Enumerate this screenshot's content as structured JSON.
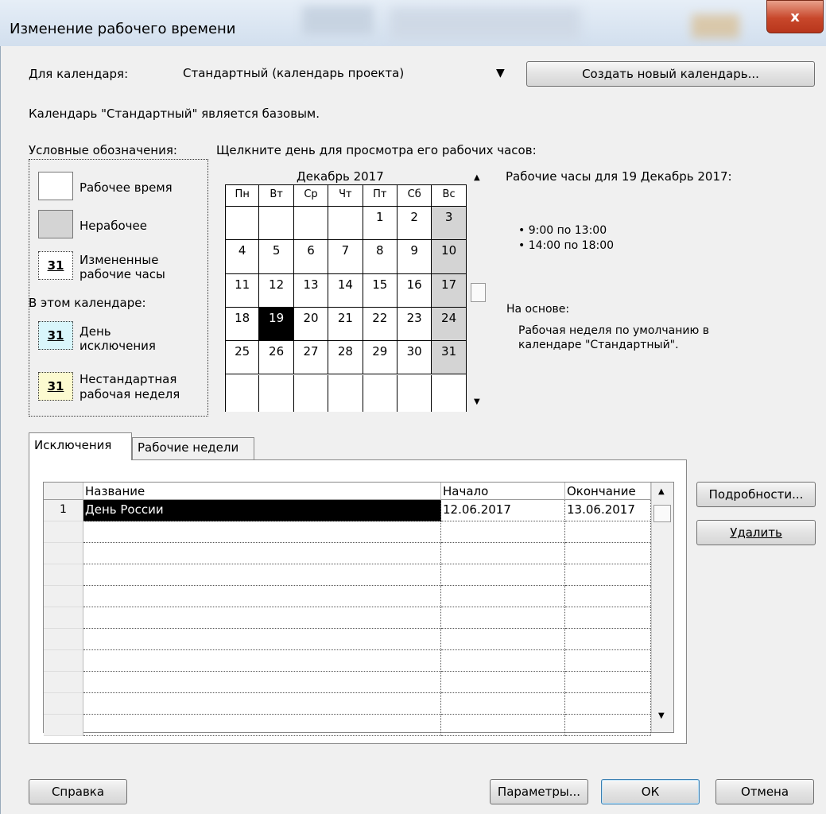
{
  "window": {
    "title": "Изменение рабочего времени",
    "close_glyph": "x"
  },
  "calendar_select": {
    "label": "Для календаря:",
    "value": "Стандартный (календарь проекта)",
    "new_button": "Создать новый календарь..."
  },
  "base_note": "Календарь \"Стандартный\" является базовым.",
  "legend": {
    "title": "Условные обозначения:",
    "working": "Рабочее время",
    "nonworking": "Нерабочее",
    "changed_num": "31",
    "changed_1": "Измененные",
    "changed_2": "рабочие часы",
    "in_calendar": "В этом календаре:",
    "exception_num": "31",
    "exception_1": "День",
    "exception_2": "исключения",
    "nonstd_num": "31",
    "nonstd_1": "Нестандартная",
    "nonstd_2": "рабочая неделя"
  },
  "calendar": {
    "instruction": "Щелкните день для просмотра его рабочих часов:",
    "month": "Декабрь 2017",
    "days": [
      "Пн",
      "Вт",
      "Ср",
      "Чт",
      "Пт",
      "Сб",
      "Вс"
    ],
    "weeks": [
      [
        "",
        "",
        "",
        "",
        "1",
        "2",
        "3"
      ],
      [
        "4",
        "5",
        "6",
        "7",
        "8",
        "9",
        "10"
      ],
      [
        "11",
        "12",
        "13",
        "14",
        "15",
        "16",
        "17"
      ],
      [
        "18",
        "19",
        "20",
        "21",
        "22",
        "23",
        "24"
      ],
      [
        "25",
        "26",
        "27",
        "28",
        "29",
        "30",
        "31"
      ],
      [
        "",
        "",
        "",
        "",
        "",
        "",
        ""
      ]
    ],
    "selected_day": "19",
    "colors": {
      "nonworking": "#d4d4d4",
      "selected": "#000000",
      "grid": "#000000"
    }
  },
  "hours": {
    "title": "Рабочие часы для 19 Декабрь 2017:",
    "ranges": [
      "• 9:00 по 13:00",
      "• 14:00 по 18:00"
    ],
    "based_on_label": "На основе:",
    "based_on_1": "Рабочая неделя по умолчанию в",
    "based_on_2": "календаре \"Стандартный\"."
  },
  "tabs": [
    {
      "label": "Исключения",
      "active": true
    },
    {
      "label": "Рабочие недели",
      "active": false
    }
  ],
  "exceptions": {
    "columns": [
      "Название",
      "Начало",
      "Окончание"
    ],
    "rows": [
      {
        "num": "1",
        "name": "День России",
        "start": "12.06.2017",
        "end": "13.06.2017"
      }
    ]
  },
  "side_buttons": {
    "details": "Подробности...",
    "delete": "Удалить"
  },
  "footer": {
    "help": "Справка",
    "options": "Параметры...",
    "ok": "ОК",
    "cancel": "Отмена"
  }
}
